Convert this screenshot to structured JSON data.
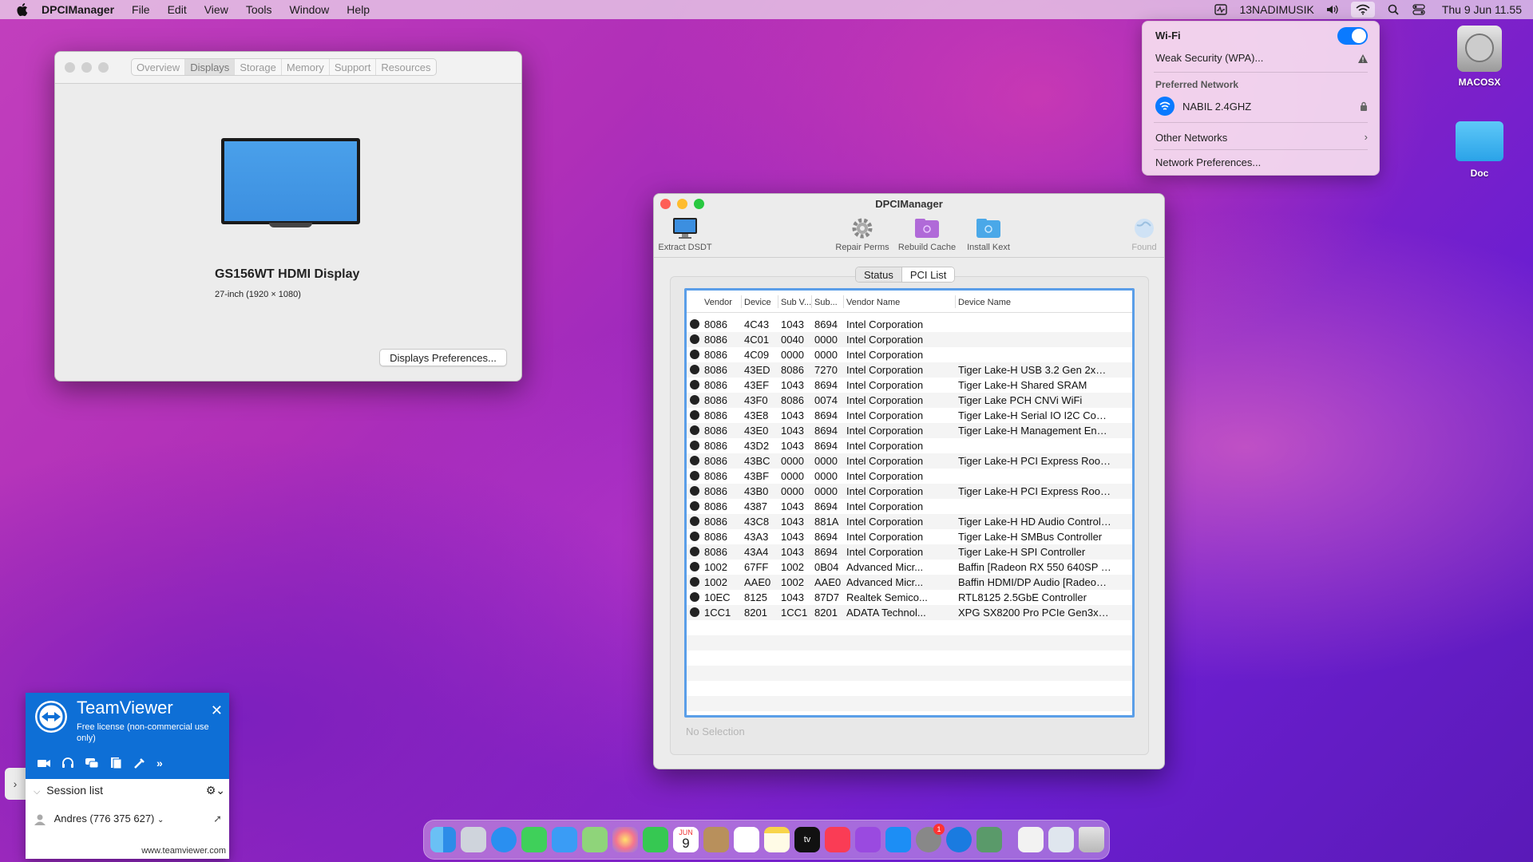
{
  "menubar": {
    "app_name": "DPCIManager",
    "menus": [
      "File",
      "Edit",
      "View",
      "Tools",
      "Window",
      "Help"
    ],
    "user": "13NADIMUSIK",
    "datetime": "Thu 9 Jun  11.55"
  },
  "wifi_menu": {
    "title": "Wi-Fi",
    "current": "Weak Security (WPA)...",
    "preferred_label": "Preferred Network",
    "preferred_name": "NABIL 2.4GHZ",
    "other": "Other Networks",
    "prefs": "Network Preferences..."
  },
  "desktop": {
    "disk_label": "MACOSX",
    "folder_label": "Doc"
  },
  "about": {
    "tabs": [
      "Overview",
      "Displays",
      "Storage",
      "Memory",
      "Support",
      "Resources"
    ],
    "selected_tab": "Displays",
    "display_name": "GS156WT HDMI Display",
    "display_spec": "27-inch (1920 × 1080)",
    "prefs_button": "Displays Preferences..."
  },
  "dpci": {
    "title": "DPCIManager",
    "toolbar": [
      "Extract DSDT",
      "Repair Perms",
      "Rebuild Cache",
      "Install Kext",
      "Found"
    ],
    "segments": [
      "Status",
      "PCI List"
    ],
    "selected_segment": "PCI List",
    "columns": [
      "Vendor",
      "Device",
      "Sub V...",
      "Sub...",
      "Vendor Name",
      "Device Name"
    ],
    "rows": [
      [
        "8086",
        "4C43",
        "1043",
        "8694",
        "Intel Corporation",
        ""
      ],
      [
        "8086",
        "4C01",
        "0040",
        "0000",
        "Intel Corporation",
        ""
      ],
      [
        "8086",
        "4C09",
        "0000",
        "0000",
        "Intel Corporation",
        ""
      ],
      [
        "8086",
        "43ED",
        "8086",
        "7270",
        "Intel Corporation",
        "Tiger Lake-H USB 3.2 Gen 2x1 xH..."
      ],
      [
        "8086",
        "43EF",
        "1043",
        "8694",
        "Intel Corporation",
        "Tiger Lake-H Shared SRAM"
      ],
      [
        "8086",
        "43F0",
        "8086",
        "0074",
        "Intel Corporation",
        "Tiger Lake PCH CNVi WiFi"
      ],
      [
        "8086",
        "43E8",
        "1043",
        "8694",
        "Intel Corporation",
        "Tiger Lake-H Serial IO I2C Contro..."
      ],
      [
        "8086",
        "43E0",
        "1043",
        "8694",
        "Intel Corporation",
        "Tiger Lake-H Management Engin..."
      ],
      [
        "8086",
        "43D2",
        "1043",
        "8694",
        "Intel Corporation",
        ""
      ],
      [
        "8086",
        "43BC",
        "0000",
        "0000",
        "Intel Corporation",
        "Tiger Lake-H PCI Express Root P..."
      ],
      [
        "8086",
        "43BF",
        "0000",
        "0000",
        "Intel Corporation",
        ""
      ],
      [
        "8086",
        "43B0",
        "0000",
        "0000",
        "Intel Corporation",
        "Tiger Lake-H PCI Express Root P..."
      ],
      [
        "8086",
        "4387",
        "1043",
        "8694",
        "Intel Corporation",
        ""
      ],
      [
        "8086",
        "43C8",
        "1043",
        "881A",
        "Intel Corporation",
        "Tiger Lake-H HD Audio Controller"
      ],
      [
        "8086",
        "43A3",
        "1043",
        "8694",
        "Intel Corporation",
        "Tiger Lake-H SMBus Controller"
      ],
      [
        "8086",
        "43A4",
        "1043",
        "8694",
        "Intel Corporation",
        "Tiger Lake-H SPI Controller"
      ],
      [
        "1002",
        "67FF",
        "1002",
        "0B04",
        "Advanced Micr...",
        "Baffin [Radeon RX 550 640SP / R..."
      ],
      [
        "1002",
        "AAE0",
        "1002",
        "AAE0",
        "Advanced Micr...",
        "Baffin HDMI/DP Audio [Radeon R..."
      ],
      [
        "10EC",
        "8125",
        "1043",
        "87D7",
        "Realtek Semico...",
        "RTL8125 2.5GbE Controller"
      ],
      [
        "1CC1",
        "8201",
        "1CC1",
        "8201",
        "ADATA Technol...",
        "XPG SX8200 Pro PCIe Gen3x4 M..."
      ]
    ],
    "status": "No Selection"
  },
  "teamviewer": {
    "title": "TeamViewer",
    "subtitle": "Free license (non-commercial use only)",
    "session_list": "Session list",
    "contact": "Andres (776 375 627)",
    "footer": "www.teamviewer.com"
  },
  "dock": {
    "calendar_month": "JUN",
    "calendar_day": "9",
    "tv_label": "tv",
    "badge": "1"
  }
}
